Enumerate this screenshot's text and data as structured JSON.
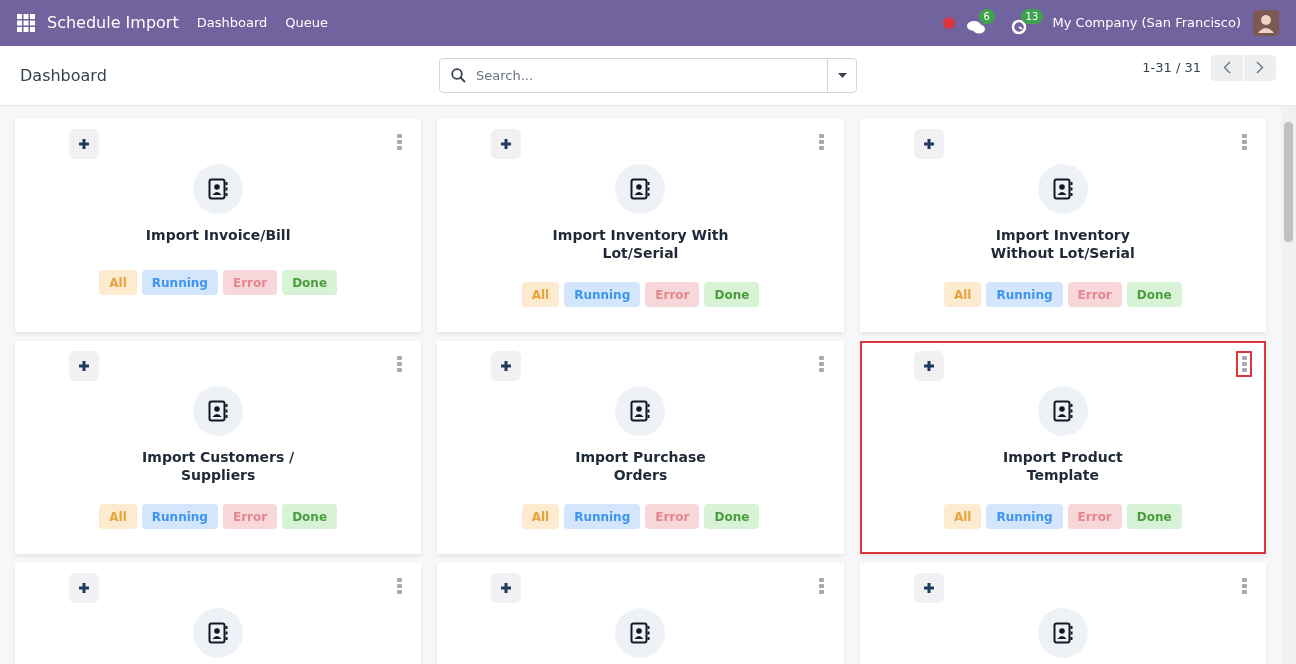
{
  "navbar": {
    "app_name": "Schedule Import",
    "menus": [
      {
        "label": "Dashboard"
      },
      {
        "label": "Queue"
      }
    ],
    "messages_count": "6",
    "activities_count": "13",
    "company": "My Company (San Francisco)"
  },
  "control_panel": {
    "breadcrumb": "Dashboard",
    "search": {
      "placeholder": "Search..."
    },
    "pager": "1-31 / 31"
  },
  "cards": [
    {
      "title_lines": [
        "Import Invoice/Bill"
      ],
      "highlighted": false,
      "chips": [
        {
          "kind": "all",
          "label": "All"
        },
        {
          "kind": "running",
          "label": "Running"
        },
        {
          "kind": "error",
          "label": "Error"
        },
        {
          "kind": "done",
          "label": "Done"
        }
      ]
    },
    {
      "title_lines": [
        "Import Inventory With",
        "Lot/Serial"
      ],
      "highlighted": false,
      "chips": [
        {
          "kind": "all",
          "label": "All"
        },
        {
          "kind": "running",
          "label": "Running"
        },
        {
          "kind": "error",
          "label": "Error"
        },
        {
          "kind": "done",
          "label": "Done"
        }
      ]
    },
    {
      "title_lines": [
        "Import Inventory",
        "Without Lot/Serial"
      ],
      "highlighted": false,
      "chips": [
        {
          "kind": "all",
          "label": "All"
        },
        {
          "kind": "running",
          "label": "Running"
        },
        {
          "kind": "error",
          "label": "Error"
        },
        {
          "kind": "done",
          "label": "Done"
        }
      ]
    },
    {
      "title_lines": [
        "Import Customers /",
        "Suppliers"
      ],
      "highlighted": false,
      "chips": [
        {
          "kind": "all",
          "label": "All"
        },
        {
          "kind": "running",
          "label": "Running"
        },
        {
          "kind": "error",
          "label": "Error"
        },
        {
          "kind": "done",
          "label": "Done"
        }
      ]
    },
    {
      "title_lines": [
        "Import Purchase",
        "Orders"
      ],
      "highlighted": false,
      "chips": [
        {
          "kind": "all",
          "label": "All"
        },
        {
          "kind": "running",
          "label": "Running"
        },
        {
          "kind": "error",
          "label": "Error"
        },
        {
          "kind": "done",
          "label": "Done"
        }
      ]
    },
    {
      "title_lines": [
        "Import Product",
        "Template"
      ],
      "highlighted": true,
      "chips": [
        {
          "kind": "all",
          "label": "All"
        },
        {
          "kind": "running",
          "label": "Running"
        },
        {
          "kind": "error",
          "label": "Error"
        },
        {
          "kind": "done",
          "label": "Done"
        }
      ]
    },
    {
      "highlighted": false
    },
    {
      "highlighted": false
    },
    {
      "highlighted": false
    }
  ]
}
